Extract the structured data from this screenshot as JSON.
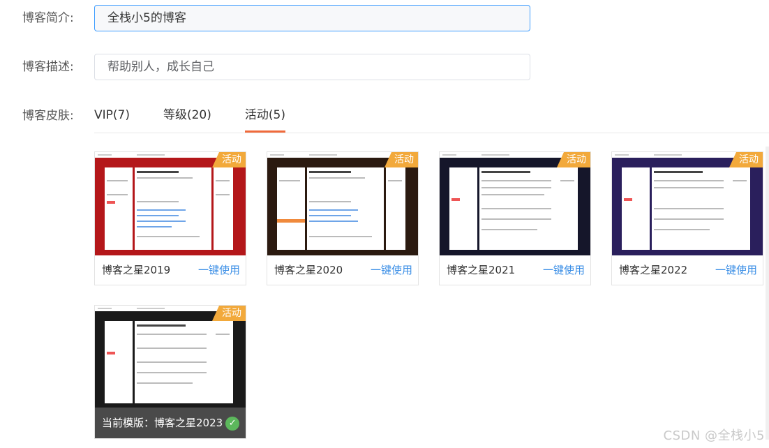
{
  "form": {
    "intro_label": "博客简介:",
    "intro_value": "全栈小5的博客",
    "desc_label": "博客描述:",
    "desc_value": "帮助别人，成长自己",
    "skin_label": "博客皮肤:"
  },
  "tabs": [
    {
      "label": "VIP(7)"
    },
    {
      "label": "等级(20)"
    },
    {
      "label": "活动(5)"
    }
  ],
  "skins": [
    {
      "name": "博客之星2019",
      "badge": "活动",
      "action": "一键使用",
      "bg": "#b4171a"
    },
    {
      "name": "博客之星2020",
      "badge": "活动",
      "action": "一键使用",
      "bg": "#2b1a10"
    },
    {
      "name": "博客之星2021",
      "badge": "活动",
      "action": "一键使用",
      "bg": "#15162a"
    },
    {
      "name": "博客之星2022",
      "badge": "活动",
      "action": "一键使用",
      "bg": "#2a1f5c"
    },
    {
      "name": "当前模版：博客之星2023",
      "badge": "活动",
      "bg": "#1a1a1a"
    }
  ],
  "colors": {
    "accent": "#f06a3b",
    "link": "#3a8ee6",
    "badge": "#f2a93b",
    "check": "#5cb85c"
  },
  "watermark": "CSDN @全栈小5"
}
